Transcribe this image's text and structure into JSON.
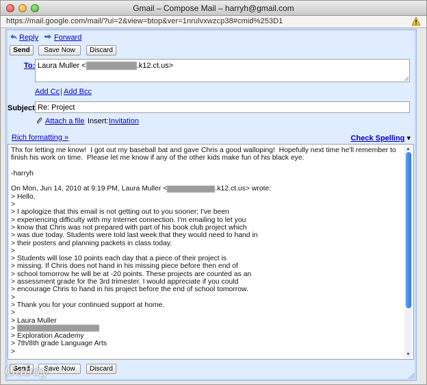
{
  "window": {
    "title": "Gmail – Compose Mail – harryh@gmail.com",
    "url": "https://mail.google.com/mail/?ui=2&view=btop&ver=1nrulvxwzcp38#cmid%253D1"
  },
  "actions": {
    "reply": "Reply",
    "forward": "Forward"
  },
  "toolbar": {
    "send": "Send",
    "save_now": "Save Now",
    "discard": "Discard"
  },
  "bottom_toolbar": {
    "send": "Send",
    "save_now": "Save Now",
    "discard": "Discard"
  },
  "to": {
    "label": "To:",
    "name": "Laura Muller",
    "email_prefix": "<",
    "email_suffix": ".k12.ct.us>"
  },
  "cc_links": {
    "add_cc": "Add Cc",
    "separator": "|",
    "add_bcc": "Add Bcc"
  },
  "subject": {
    "label": "Subject:",
    "value": "Re: Project"
  },
  "attach": {
    "attach_label": "Attach a file",
    "insert_label": "Insert:",
    "invitation_label": "Invitation"
  },
  "format": {
    "rich": "Rich formatting »",
    "spell": "Check Spelling",
    "spell_arrow": "▾"
  },
  "message": {
    "line1": "Thx for letting me know!  I got out my baseball bat and gave Chris a good walloping!  Hopefully next time he'll remember to",
    "line2": "finish his work on time.  Please let me know if any of the other kids make fun of his black eye.",
    "line3": "",
    "line4": "-harryh",
    "line5": "",
    "quote_header_pre": "On Mon, Jun 14, 2010 at 9:19 PM, Laura Muller <",
    "quote_header_post": ".k12.ct.us> wrote:",
    "quoted": [
      "> Hello,",
      ">",
      "> I apologize that this email is not getting out to you sooner; I've been",
      "> experiencing difficulty with my Internet connection. I'm emailing to let you",
      "> know that Chris was not prepared with part of his book club project which",
      "> was due today. Students were told last week that they would need to hand in",
      "> their posters and planning packets in class today.",
      ">",
      "> Students will lose 10 points each day that a piece of their project is",
      "> missing. If Chris does not hand in his missing piece before then end of",
      "> school tomorrow he will be at -20 points. These projects are counted as an",
      "> assessment grade for the 3rd trimester. I would appreciate if you could",
      "> encourage Chris to hand in his project before the end of school tomorrow.",
      ">",
      "> Thank you for your continued support at home.",
      ">",
      "> Laura Muller"
    ],
    "sig_prefix": "> ",
    "sig_tail": [
      "> Exploration Academy",
      "> 7th/8th grade Language Arts",
      ">"
    ]
  },
  "watermark": "Gabay"
}
